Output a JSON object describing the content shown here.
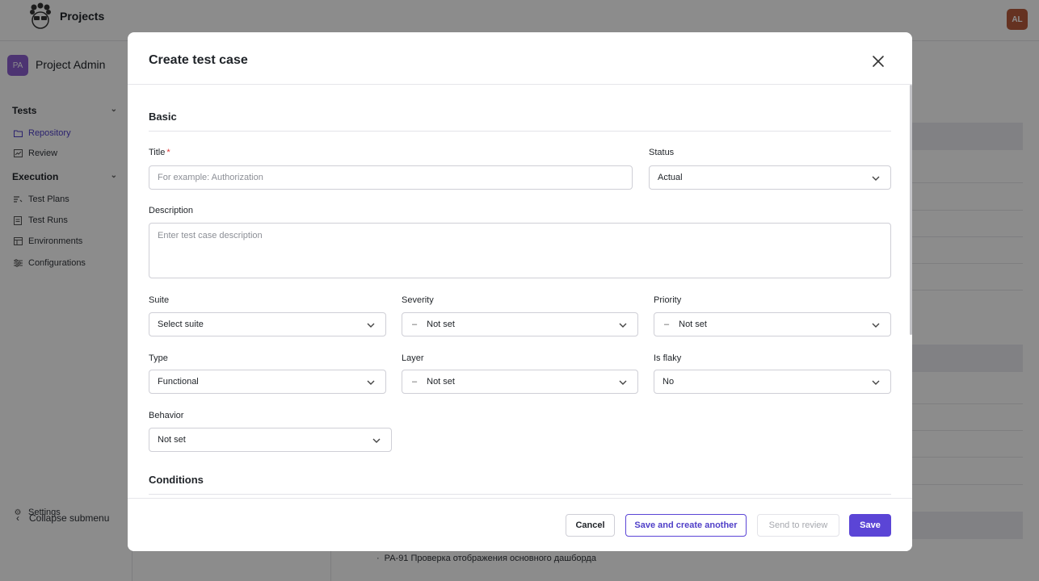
{
  "app": {
    "title": "Projects",
    "user_initials": "AL"
  },
  "sidebar": {
    "project_initials": "PA",
    "project_name": "Project Admin",
    "groups": [
      {
        "label": "Tests",
        "items": [
          {
            "label": "Repository",
            "icon": "folder-icon",
            "active": true
          },
          {
            "label": "Review",
            "icon": "review-icon"
          }
        ]
      },
      {
        "label": "Execution",
        "items": [
          {
            "label": "Test Plans",
            "icon": "plans-icon"
          },
          {
            "label": "Test Runs",
            "icon": "runs-icon"
          },
          {
            "label": "Environments",
            "icon": "environments-icon"
          },
          {
            "label": "Configurations",
            "icon": "sliders-icon"
          }
        ]
      }
    ],
    "settings_label": "Settings",
    "collapse_label": "Collapse submenu"
  },
  "background": {
    "bottom_row_text": "PA-91 Проверка отображения основного дашборда"
  },
  "modal": {
    "title": "Create test case",
    "sections": {
      "basic": "Basic",
      "conditions": "Conditions"
    },
    "fields": {
      "title": {
        "label": "Title",
        "required_mark": "*",
        "placeholder": "For example: Authorization",
        "value": ""
      },
      "status": {
        "label": "Status",
        "value": "Actual"
      },
      "description": {
        "label": "Description",
        "placeholder": "Enter test case description",
        "value": ""
      },
      "suite": {
        "label": "Suite",
        "value": "Select suite"
      },
      "severity": {
        "label": "Severity",
        "value": "Not set"
      },
      "priority": {
        "label": "Priority",
        "value": "Not set"
      },
      "type": {
        "label": "Type",
        "value": "Functional"
      },
      "layer": {
        "label": "Layer",
        "value": "Not set"
      },
      "is_flaky": {
        "label": "Is flaky",
        "value": "No"
      },
      "behavior": {
        "label": "Behavior",
        "value": "Not set"
      }
    },
    "footer": {
      "cancel": "Cancel",
      "save_another": "Save and create another",
      "send_review": "Send to review",
      "save": "Save"
    }
  },
  "colors": {
    "accent": "#5b45d6",
    "overlay": "rgba(0,0,0,0.45)"
  }
}
